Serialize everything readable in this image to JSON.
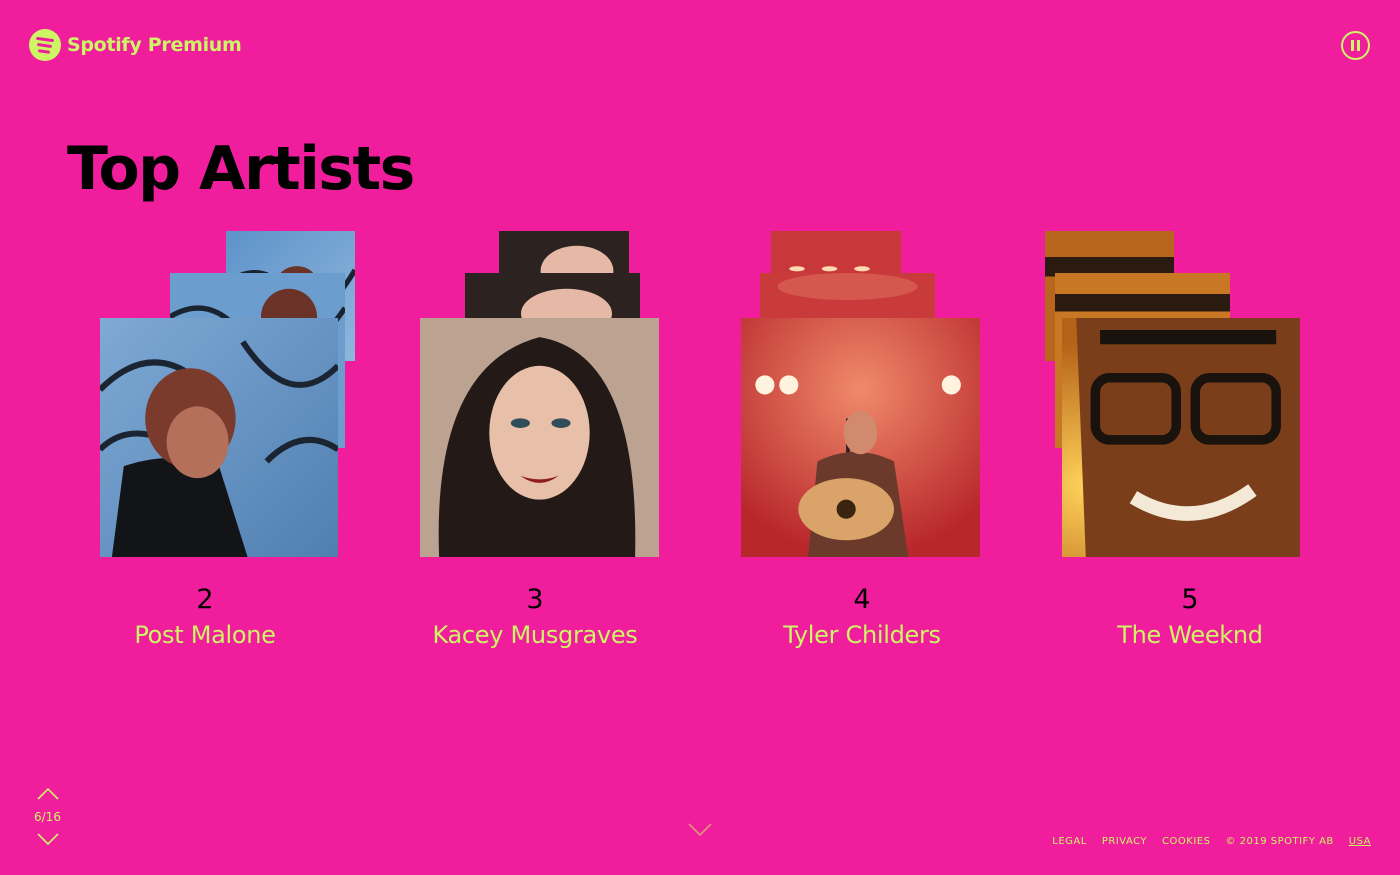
{
  "brand": {
    "name": "Spotify Premium"
  },
  "controls": {
    "pause_label": "Pause"
  },
  "page": {
    "title": "Top Artists",
    "counter": "6/16"
  },
  "artists": [
    {
      "rank": "2",
      "name": "Post Malone"
    },
    {
      "rank": "3",
      "name": "Kacey Musgraves"
    },
    {
      "rank": "4",
      "name": "Tyler Childers"
    },
    {
      "rank": "5",
      "name": "The Weeknd"
    }
  ],
  "footer": {
    "legal": "LEGAL",
    "privacy": "PRIVACY",
    "cookies": "COOKIES",
    "copyright": "© 2019 SPOTIFY AB",
    "region": "USA"
  },
  "colors": {
    "background": "#f01e9c",
    "accent": "#cdf564",
    "title": "#000000"
  },
  "icons": {
    "logo": "spotify-logo-icon",
    "pause": "pause-icon",
    "prev": "chevron-up-icon",
    "next": "chevron-down-icon"
  }
}
